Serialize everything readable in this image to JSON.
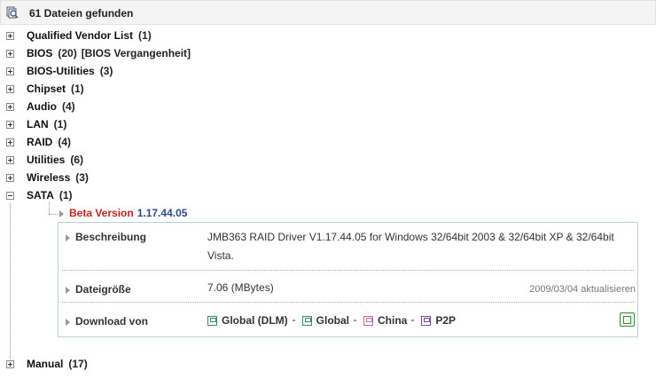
{
  "header": {
    "title": "61 Dateien gefunden",
    "icon": "search-files-icon"
  },
  "categories": [
    {
      "label": "Qualified Vendor List",
      "count": "(1)",
      "extra": "",
      "expanded": false
    },
    {
      "label": "BIOS",
      "count": "(20)",
      "extra": "[BIOS Vergangenheit]",
      "expanded": false
    },
    {
      "label": "BIOS-Utilities",
      "count": "(3)",
      "extra": "",
      "expanded": false
    },
    {
      "label": "Chipset",
      "count": "(1)",
      "extra": "",
      "expanded": false
    },
    {
      "label": "Audio",
      "count": "(4)",
      "extra": "",
      "expanded": false
    },
    {
      "label": "LAN",
      "count": "(1)",
      "extra": "",
      "expanded": false
    },
    {
      "label": "RAID",
      "count": "(4)",
      "extra": "",
      "expanded": false
    },
    {
      "label": "Utilities",
      "count": "(6)",
      "extra": "",
      "expanded": false
    },
    {
      "label": "Wireless",
      "count": "(3)",
      "extra": "",
      "expanded": false
    },
    {
      "label": "SATA",
      "count": "(1)",
      "extra": "",
      "expanded": true
    },
    {
      "label": "Manual",
      "count": "(17)",
      "extra": "",
      "expanded": false
    }
  ],
  "file": {
    "beta_label": "Beta Version",
    "version": "1.17.44.05",
    "description_label": "Beschreibung",
    "description_line1": "JMB363 RAID Driver V1.17.44.05 for Windows 32/64bit 2003 & 32/64bit XP & 32/64bit",
    "description_line2": "Vista.",
    "size_label": "Dateigröße",
    "size_value": "7.06 (MBytes)",
    "date": "2009/03/04 aktualisieren",
    "download_label": "Download von",
    "mirrors": [
      {
        "label": "Global (DLM)",
        "color": "#3a8a6a"
      },
      {
        "label": "Global",
        "color": "#3a8a6a"
      },
      {
        "label": "China",
        "color": "#c46aa8"
      },
      {
        "label": "P2P",
        "color": "#7a4a9a"
      }
    ]
  },
  "colors": {
    "beta": "#cc2222",
    "version": "#2a4a8a",
    "box_border": "#bcd0e0"
  }
}
